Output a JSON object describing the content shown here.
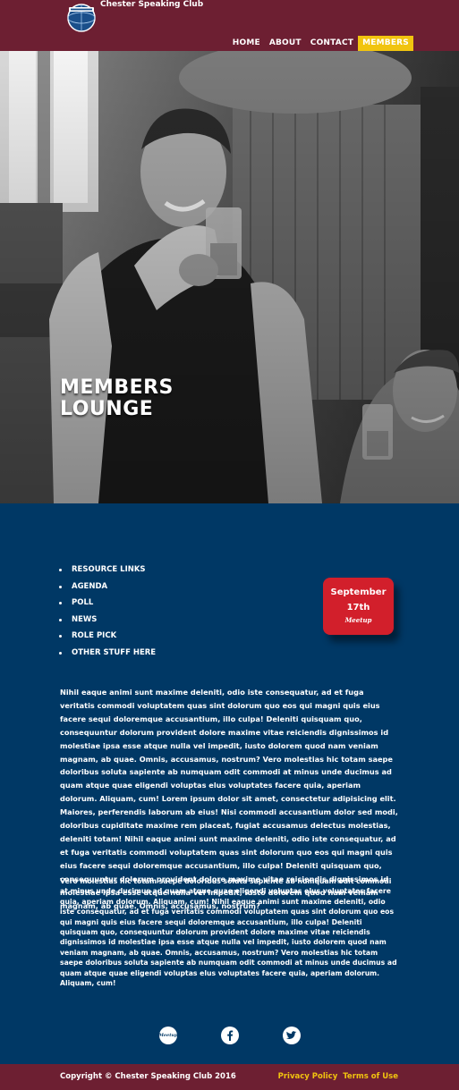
{
  "header": {
    "site_title": "Chester Speaking Club",
    "nav": [
      "HOME",
      "ABOUT",
      "CONTACT",
      "MEMBERS"
    ],
    "active_nav": "MEMBERS"
  },
  "hero": {
    "title_line1": "MEMBERS",
    "title_line2": "LOUNGE"
  },
  "sidebar": {
    "items": [
      "RESOURCE LINKS",
      "AGENDA",
      "POLL",
      "NEWS",
      "ROLE PICK",
      "OTHER STUFF HERE"
    ]
  },
  "event": {
    "month": "September",
    "day": "17th",
    "source": "Meetup"
  },
  "content": {
    "paragraph1": "Nihil eaque animi sunt maxime deleniti, odio iste consequatur, ad et fuga veritatis commodi voluptatem quas sint dolorum quo eos qui magni quis eius facere sequi doloremque accusantium, illo culpa! Deleniti quisquam quo, consequuntur dolorum provident dolore maxime vitae reiciendis dignissimos id molestiae ipsa esse atque nulla vel impedit, iusto dolorem quod nam veniam magnam, ab quae. Omnis, accusamus, nostrum? Vero molestias hic totam saepe doloribus soluta sapiente ab numquam odit commodi at minus unde ducimus ad quam atque quae eligendi voluptas elus voluptates facere quia, aperiam dolorum. Aliquam, cum! Lorem ipsum dolor sit amet, consectetur adipisicing elit. Maiores, perferendis laborum ab eius! Nisi commodi accusantium dolor sed modi, doloribus cupiditate maxime rem placeat, fugiat accusamus delectus molestias, deleniti totam! Nihil eaque animi sunt maxime deleniti, odio iste consequatur, ad et fuga veritatis commodi voluptatem quas sint dolorum quo eos qui magni quis eius facere sequi doloremque accusantium, illo culpa! Deleniti quisquam quo, consequuntur dolorum provident dolore maxime vitae reiciendis dignissimos id molestiae ipsa esse atque nulla vel impedit, iusto dolorem quod nam veniam magnam, ab quae. Omnis, accusamus, nostrum?",
    "paragraph2": "Vero molestias hic totam saepe doloribus soluta sapiente ab numquam odit commodi at minus unde ducimus ad quam atque quae eligendi voluptas elus voluptates facere quia, aperiam dolorum. Aliquam, cum! Nihil eaque animi sunt maxime deleniti, odio iste consequatur, ad et fuga veritatis commodi voluptatem quas sint dolorum quo eos qui magni quis eius facere sequi doloremque accusantium, illo culpa! Deleniti quisquam quo, consequuntur dolorum provident dolore maxime vitae reiciendis dignissimos id molestiae ipsa esse atque nulla vel impedit, iusto dolorem quod nam veniam magnam, ab quae. Omnis, accusamus, nostrum? Vero molestias hic totam saepe doloribus soluta sapiente ab numquam odit commodi at minus unde ducimus ad quam atque quae eligendi voluptas elus voluptates facere quia, aperiam dolorum. Aliquam, cum!"
  },
  "social": {
    "meetup_label": "Meetup",
    "icons": [
      "meetup-icon",
      "facebook-icon",
      "twitter-icon"
    ]
  },
  "footer": {
    "copyright": "Copyright © Chester Speaking Club 2016",
    "links": [
      "Privacy Policy",
      "Terms of Use"
    ]
  },
  "colors": {
    "header_bg": "#6d1f32",
    "body_bg": "#003865",
    "accent": "#f1c40f",
    "event_red": "#d21f2b"
  }
}
